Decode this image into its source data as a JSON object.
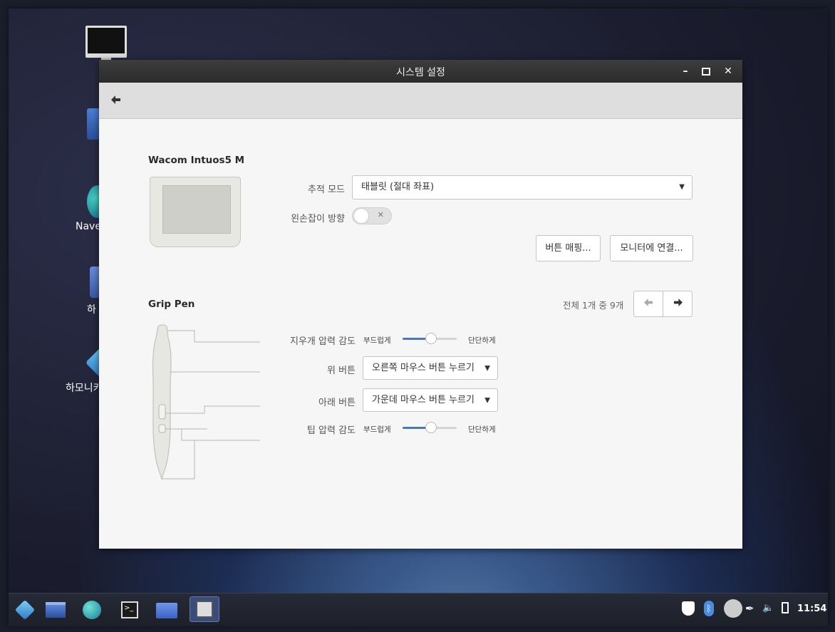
{
  "desktop": {
    "icons": [
      {
        "label": "컴"
      },
      {
        "label": ""
      },
      {
        "label": "Nave"
      },
      {
        "label": "하"
      },
      {
        "label": "하모니카"
      }
    ]
  },
  "window": {
    "title": "시스템 설정",
    "controls": {
      "minimize": "–",
      "maximize": "□",
      "close": "✕"
    },
    "back_icon": "🡐"
  },
  "tablet": {
    "name": "Wacom Intuos5 M",
    "tracking_mode_label": "추적 모드",
    "tracking_mode_value": "태블릿 (절대 좌표)",
    "left_handed_label": "왼손잡이 방향",
    "left_handed_on": false,
    "map_buttons_label": "버튼 매핑...",
    "map_monitor_label": "모니터에 연결..."
  },
  "stylus": {
    "name": "Grip Pen",
    "pager_text": "전체 1개 중 9개",
    "eraser_pressure_label": "지우개 압력 감도",
    "soft_label": "부드럽게",
    "firm_label": "단단하게",
    "eraser_pressure_value": 0.52,
    "upper_button_label": "위 버튼",
    "upper_button_value": "오른쪽 마우스 버튼 누르기",
    "lower_button_label": "아래 버튼",
    "lower_button_value": "가운데 마우스 버튼 누르기",
    "tip_pressure_label": "팁 압력 감도",
    "tip_pressure_value": 0.52
  },
  "taskbar": {
    "clock": "11:54",
    "items": [
      "harmonica-menu-icon",
      "window-icon",
      "browser-icon",
      "terminal-icon",
      "files-icon",
      "settings-icon"
    ]
  },
  "colors": {
    "accent": "#4a78c0"
  }
}
